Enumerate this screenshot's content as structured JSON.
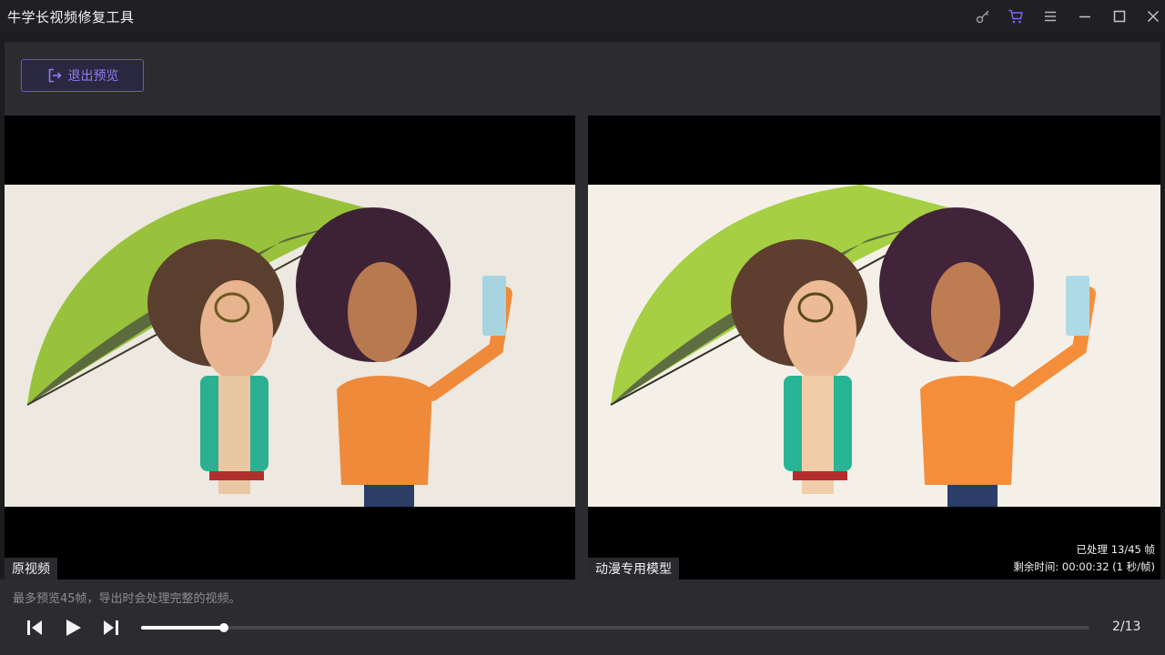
{
  "app": {
    "title": "牛学长视频修复工具"
  },
  "window_controls": [
    "key-icon",
    "cart-icon",
    "menu-icon",
    "minimize-icon",
    "maximize-icon",
    "close-icon"
  ],
  "colors": {
    "accent": "#6b56d6",
    "cart": "#7a64ff",
    "background": "#2c2c30"
  },
  "toolbar": {
    "exit_preview_label": "退出预览"
  },
  "preview": {
    "left_label": "原视频",
    "right_label": "动漫专用模型",
    "processed": "已处理 13/45 帧",
    "remaining": "剩余时间: 00:00:32 (1 秒/帧)"
  },
  "footer": {
    "hint": "最多预览45帧，导出时会处理完整的视频。",
    "progress": 0.087,
    "page_counter": "2/13"
  }
}
